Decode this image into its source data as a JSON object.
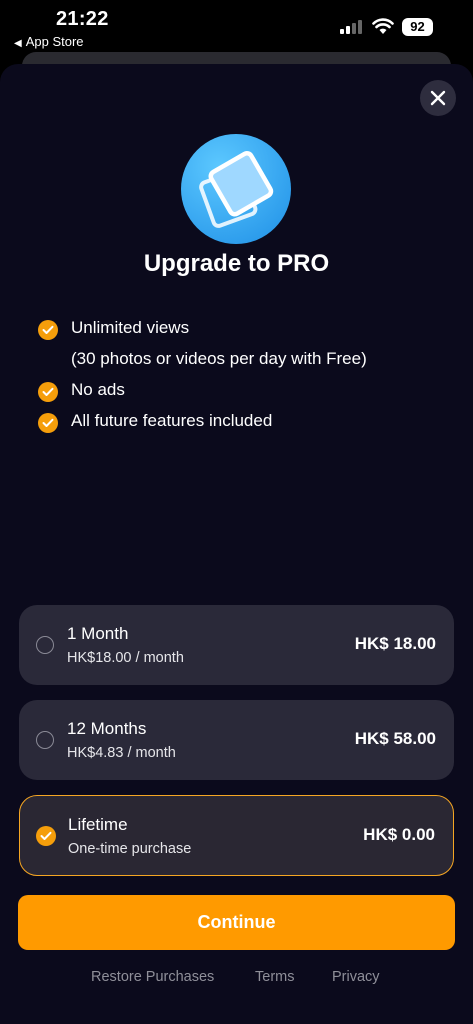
{
  "status_bar": {
    "time": "21:22",
    "back_label": "App Store",
    "battery": "92"
  },
  "paywall": {
    "title": "Upgrade to PRO",
    "features": [
      {
        "label": "Unlimited views",
        "checked": true
      },
      {
        "label": "(30 photos or videos per day with Free)",
        "checked": false
      },
      {
        "label": "No ads",
        "checked": true
      },
      {
        "label": "All future features included",
        "checked": true
      }
    ],
    "plans": [
      {
        "name": "1 Month",
        "sub": "HK$18.00 / month",
        "price": "HK$ 18.00",
        "selected": false
      },
      {
        "name": "12 Months",
        "sub": "HK$4.83 / month",
        "price": "HK$ 58.00",
        "selected": false
      },
      {
        "name": "Lifetime",
        "sub": "One-time purchase",
        "price": "HK$ 0.00",
        "selected": true
      }
    ],
    "continue_label": "Continue",
    "footer": {
      "restore": "Restore Purchases",
      "terms": "Terms",
      "privacy": "Privacy"
    }
  },
  "colors": {
    "accent": "#ff9a00",
    "background": "#0b0a1c",
    "card": "#2a2939"
  }
}
